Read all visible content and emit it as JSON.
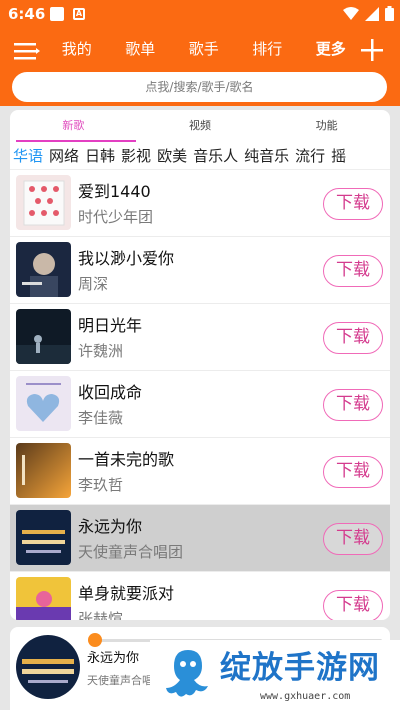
{
  "status_bar": {
    "time": "6:46"
  },
  "app_bar": {
    "nav": [
      "我的",
      "歌单",
      "歌手",
      "排行",
      "更多"
    ]
  },
  "search": {
    "placeholder": "点我/搜索/歌手/歌名"
  },
  "tabs": [
    "新歌",
    "视频",
    "功能"
  ],
  "categories": [
    "华语",
    "网络",
    "日韩",
    "影视",
    "欧美",
    "音乐人",
    "纯音乐",
    "流行",
    "摇"
  ],
  "download_label": "下载",
  "songs": [
    {
      "title": "爱到1440",
      "artist": "时代少年团"
    },
    {
      "title": "我以渺小爱你",
      "artist": "周深"
    },
    {
      "title": "明日光年",
      "artist": "许魏洲"
    },
    {
      "title": "收回成命",
      "artist": "李佳薇"
    },
    {
      "title": "一首未完的歌",
      "artist": "李玖哲"
    },
    {
      "title": "永远为你",
      "artist": "天使童声合唱团"
    },
    {
      "title": "单身就要派对",
      "artist": "张赫愃"
    }
  ],
  "player": {
    "song": "永远为你",
    "artist": "天使童声合唱团",
    "progress": 0.0
  },
  "watermark": {
    "title": "绽放手游网",
    "url": "www.gxhuaer.com"
  },
  "colors": {
    "primary": "#fb6a12",
    "accent_pink": "#e33fc2",
    "category_active": "#2196f3",
    "download_border": "#f06ab8"
  }
}
